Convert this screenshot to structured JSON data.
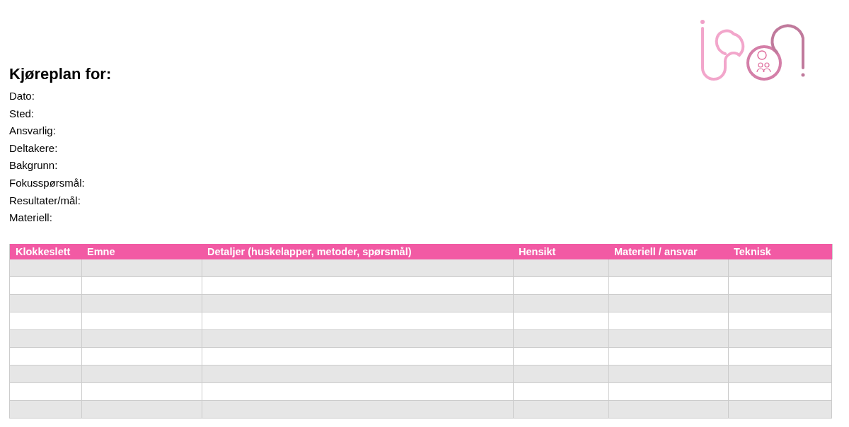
{
  "document": {
    "title": "Kjøreplan for:",
    "fields": [
      {
        "label": "Dato:"
      },
      {
        "label": "Sted:"
      },
      {
        "label": "Ansvarlig:"
      },
      {
        "label": "Deltakere:"
      },
      {
        "label": "Bakgrunn:"
      },
      {
        "label": "Fokusspørsmål:"
      },
      {
        "label": "Resultater/mål:"
      },
      {
        "label": "Materiell:"
      }
    ]
  },
  "table": {
    "columns": [
      "Klokkeslett",
      "Emne",
      "Detaljer (huskelapper, metoder, spørsmål)",
      "Hensikt",
      "Materiell / ansvar",
      "Teknisk"
    ],
    "rows": [
      {
        "shaded": true
      },
      {
        "shaded": false
      },
      {
        "shaded": true
      },
      {
        "shaded": false
      },
      {
        "shaded": true
      },
      {
        "shaded": false
      },
      {
        "shaded": true
      },
      {
        "shaded": false
      },
      {
        "shaded": true
      }
    ]
  }
}
